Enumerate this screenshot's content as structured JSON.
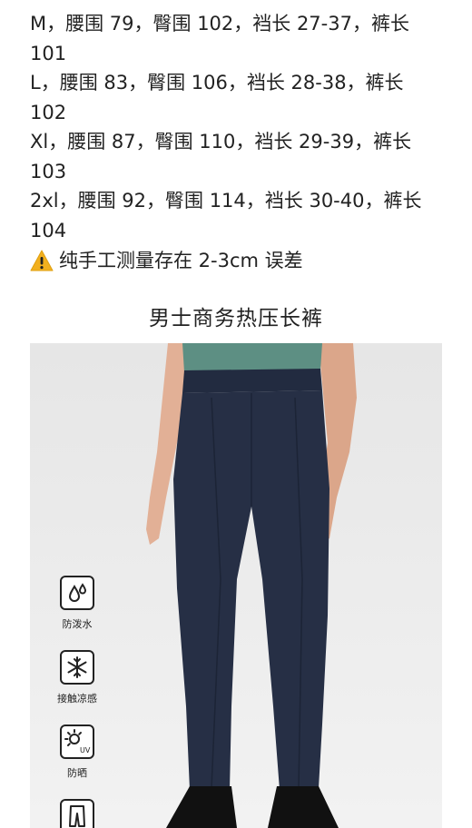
{
  "size_lines": [
    "M，腰围 79，臀围 102，裆长 27-37，裤长",
    "101",
    "L，腰围 83，臀围 106，裆长 28-38，裤长",
    "102",
    "Xl，腰围 87，臀围 110，裆长 29-39，裤长",
    "103",
    "2xl，腰围 92，臀围 114，裆长 30-40，裤长",
    "104"
  ],
  "note": "纯手工测量存在 2-3cm 误差",
  "product_title": "男士商务热压长裤",
  "features": [
    {
      "icon": "water-repellent-icon",
      "label": "防泼水"
    },
    {
      "icon": "cooling-snowflake-icon",
      "label": "接触凉感"
    },
    {
      "icon": "uv-sun-icon",
      "label": "防晒"
    },
    {
      "icon": "trousers-icon",
      "label": ""
    }
  ],
  "colors": {
    "pants": "#262f45",
    "shirt": "#5d8f83",
    "skin": "#e2b096",
    "background": "#ededed",
    "warning": "#f2b01e"
  }
}
